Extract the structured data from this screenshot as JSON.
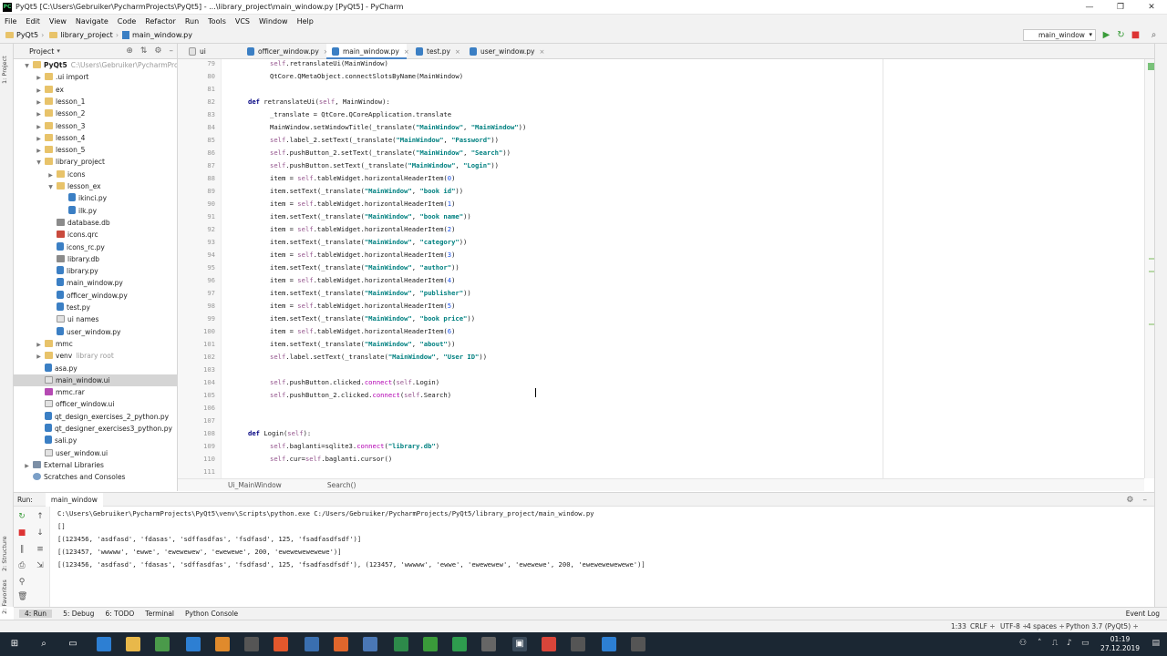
{
  "window": {
    "title": "PyQt5 [C:\\Users\\Gebruiker\\PycharmProjects\\PyQt5] - ...\\library_project\\main_window.py [PyQt5] - PyCharm",
    "minimize": "—",
    "maximize": "❐",
    "close": "✕"
  },
  "menu": [
    "File",
    "Edit",
    "View",
    "Navigate",
    "Code",
    "Refactor",
    "Run",
    "Tools",
    "VCS",
    "Window",
    "Help"
  ],
  "navbar": {
    "crumbs": [
      "PyQt5",
      "library_project",
      "main_window.py"
    ],
    "run_config": "main_window"
  },
  "left_strip": {
    "project": "1: Project",
    "structure": "2: Structure",
    "favorites": "2: Favorites"
  },
  "project_panel": {
    "title": "Project",
    "items": [
      {
        "arrow": "▼",
        "icon": "folder",
        "name": "PyQt5",
        "path": "C:\\Users\\Gebruiker\\PycharmProjects",
        "bold": true,
        "depth": 0
      },
      {
        "arrow": "▶",
        "icon": "folder",
        "name": ".ui import",
        "depth": 1
      },
      {
        "arrow": "▶",
        "icon": "folder",
        "name": "ex",
        "depth": 1
      },
      {
        "arrow": "▶",
        "icon": "folder",
        "name": "lesson_1",
        "depth": 1
      },
      {
        "arrow": "▶",
        "icon": "folder",
        "name": "lesson_2",
        "depth": 1
      },
      {
        "arrow": "▶",
        "icon": "folder",
        "name": "lesson_3",
        "depth": 1
      },
      {
        "arrow": "▶",
        "icon": "folder",
        "name": "lesson_4",
        "depth": 1
      },
      {
        "arrow": "▶",
        "icon": "folder",
        "name": "lesson_5",
        "depth": 1
      },
      {
        "arrow": "▼",
        "icon": "folder",
        "name": "library_project",
        "depth": 1
      },
      {
        "arrow": "▶",
        "icon": "folder",
        "name": "icons",
        "depth": 2
      },
      {
        "arrow": "▼",
        "icon": "folder",
        "name": "lesson_ex",
        "depth": 2
      },
      {
        "arrow": "",
        "icon": "py",
        "name": "ikinci.py",
        "depth": 3
      },
      {
        "arrow": "",
        "icon": "py",
        "name": "ilk.py",
        "depth": 3
      },
      {
        "arrow": "",
        "icon": "db",
        "name": "database.db",
        "depth": 2
      },
      {
        "arrow": "",
        "icon": "qrc",
        "name": "icons.qrc",
        "depth": 2
      },
      {
        "arrow": "",
        "icon": "py",
        "name": "icons_rc.py",
        "depth": 2
      },
      {
        "arrow": "",
        "icon": "db",
        "name": "library.db",
        "depth": 2
      },
      {
        "arrow": "",
        "icon": "py",
        "name": "library.py",
        "depth": 2
      },
      {
        "arrow": "",
        "icon": "py",
        "name": "main_window.py",
        "depth": 2
      },
      {
        "arrow": "",
        "icon": "py",
        "name": "officer_window.py",
        "depth": 2
      },
      {
        "arrow": "",
        "icon": "py",
        "name": "test.py",
        "depth": 2
      },
      {
        "arrow": "",
        "icon": "ui",
        "name": "ui names",
        "depth": 2
      },
      {
        "arrow": "",
        "icon": "py",
        "name": "user_window.py",
        "depth": 2
      },
      {
        "arrow": "▶",
        "icon": "folder",
        "name": "mmc",
        "depth": 1
      },
      {
        "arrow": "▶",
        "icon": "folder",
        "name": "venv",
        "path": "library root",
        "depth": 1
      },
      {
        "arrow": "",
        "icon": "py",
        "name": "asa.py",
        "depth": 1
      },
      {
        "arrow": "",
        "icon": "ui",
        "name": "main_window.ui",
        "depth": 1,
        "selected": true
      },
      {
        "arrow": "",
        "icon": "rar",
        "name": "mmc.rar",
        "depth": 1
      },
      {
        "arrow": "",
        "icon": "ui",
        "name": "officer_window.ui",
        "depth": 1
      },
      {
        "arrow": "",
        "icon": "py",
        "name": "qt_design_exercises_2_python.py",
        "depth": 1
      },
      {
        "arrow": "",
        "icon": "py",
        "name": "qt_designer_exercises3_python.py",
        "depth": 1
      },
      {
        "arrow": "",
        "icon": "py",
        "name": "sali.py",
        "depth": 1
      },
      {
        "arrow": "",
        "icon": "ui",
        "name": "user_window.ui",
        "depth": 1
      },
      {
        "arrow": "▶",
        "icon": "lib",
        "name": "External Libraries",
        "depth": 0
      },
      {
        "arrow": "",
        "icon": "scr",
        "name": "Scratches and Consoles",
        "depth": 0
      }
    ]
  },
  "editor_tabs": [
    {
      "name": "ui names",
      "icon": "ui",
      "active": false
    },
    {
      "name": "officer_window.py",
      "icon": "py",
      "active": false
    },
    {
      "name": "main_window.py",
      "icon": "py",
      "active": true
    },
    {
      "name": "test.py",
      "icon": "py",
      "active": false
    },
    {
      "name": "user_window.py",
      "icon": "py",
      "active": false
    }
  ],
  "code": {
    "first_line": 79,
    "lines": [
      {
        "i": 2,
        "t": "self.retranslateUi(MainWindow)"
      },
      {
        "i": 2,
        "t": "QtCore.QMetaObject.connectSlotsByName(MainWindow)"
      },
      {
        "i": 0,
        "t": ""
      },
      {
        "i": 1,
        "t": "def retranslateUi(self, MainWindow):"
      },
      {
        "i": 2,
        "t": "_translate = QtCore.QCoreApplication.translate"
      },
      {
        "i": 2,
        "t": "MainWindow.setWindowTitle(_translate(\"MainWindow\", \"MainWindow\"))"
      },
      {
        "i": 2,
        "t": "self.label_2.setText(_translate(\"MainWindow\", \"Password\"))"
      },
      {
        "i": 2,
        "t": "self.pushButton_2.setText(_translate(\"MainWindow\", \"Search\"))"
      },
      {
        "i": 2,
        "t": "self.pushButton.setText(_translate(\"MainWindow\", \"Login\"))"
      },
      {
        "i": 2,
        "t": "item = self.tableWidget.horizontalHeaderItem(0)"
      },
      {
        "i": 2,
        "t": "item.setText(_translate(\"MainWindow\", \"book id\"))"
      },
      {
        "i": 2,
        "t": "item = self.tableWidget.horizontalHeaderItem(1)"
      },
      {
        "i": 2,
        "t": "item.setText(_translate(\"MainWindow\", \"book name\"))"
      },
      {
        "i": 2,
        "t": "item = self.tableWidget.horizontalHeaderItem(2)"
      },
      {
        "i": 2,
        "t": "item.setText(_translate(\"MainWindow\", \"category\"))"
      },
      {
        "i": 2,
        "t": "item = self.tableWidget.horizontalHeaderItem(3)"
      },
      {
        "i": 2,
        "t": "item.setText(_translate(\"MainWindow\", \"author\"))"
      },
      {
        "i": 2,
        "t": "item = self.tableWidget.horizontalHeaderItem(4)"
      },
      {
        "i": 2,
        "t": "item.setText(_translate(\"MainWindow\", \"publisher\"))"
      },
      {
        "i": 2,
        "t": "item = self.tableWidget.horizontalHeaderItem(5)"
      },
      {
        "i": 2,
        "t": "item.setText(_translate(\"MainWindow\", \"book price\"))"
      },
      {
        "i": 2,
        "t": "item = self.tableWidget.horizontalHeaderItem(6)"
      },
      {
        "i": 2,
        "t": "item.setText(_translate(\"MainWindow\", \"about\"))"
      },
      {
        "i": 2,
        "t": "self.label.setText(_translate(\"MainWindow\", \"User ID\"))"
      },
      {
        "i": 0,
        "t": ""
      },
      {
        "i": 2,
        "t": "self.pushButton.clicked.connect(self.Login)"
      },
      {
        "i": 2,
        "t": "self.pushButton_2.clicked.connect(self.Search)"
      },
      {
        "i": 0,
        "t": ""
      },
      {
        "i": 0,
        "t": ""
      },
      {
        "i": 1,
        "t": "def Login(self):"
      },
      {
        "i": 2,
        "t": "self.baglanti=sqlite3.connect(\"library.db\")"
      },
      {
        "i": 2,
        "t": "self.cur=self.baglanti.cursor()"
      },
      {
        "i": 0,
        "t": ""
      }
    ]
  },
  "editor_breadcrumb": [
    "Ui_MainWindow",
    "Search()"
  ],
  "run_panel": {
    "label": "Run:",
    "tab": "main_window",
    "output": [
      "C:\\Users\\Gebruiker\\PycharmProjects\\PyQt5\\venv\\Scripts\\python.exe C:/Users/Gebruiker/PycharmProjects/PyQt5/library_project/main_window.py",
      "[]",
      "[(123456, 'asdfasd', 'fdasas', 'sdffasdfas', 'fsdfasd', 125, 'fsadfasdfsdf')]",
      "[(123457, 'wwwww', 'ewwe', 'ewewewew', 'ewewewe', 200, 'ewewewewewewe')]",
      "[(123456, 'asdfasd', 'fdasas', 'sdffasdfas', 'fsdfasd', 125, 'fsadfasdfsdf'), (123457, 'wwwww', 'ewwe', 'ewewewew', 'ewewewe', 200, 'ewewewewewewe')]"
    ]
  },
  "tool_windows": [
    "4: Run",
    "5: Debug",
    "6: TODO",
    "Terminal",
    "Python Console"
  ],
  "event_log": "Event Log",
  "status": {
    "position": "1:33",
    "line_sep": "CRLF ÷",
    "encoding": "UTF-8 ÷",
    "indent": "4 spaces ÷",
    "interpreter": "Python 3.7 (PyQt5) ÷"
  },
  "taskbar": {
    "time": "01:19",
    "date": "27.12.2019"
  },
  "colors": {
    "keyword": "#000080",
    "self": "#94558d",
    "string": "#008080",
    "number": "#1750eb",
    "method": "#b200b2",
    "accent": "#4a86c8"
  }
}
